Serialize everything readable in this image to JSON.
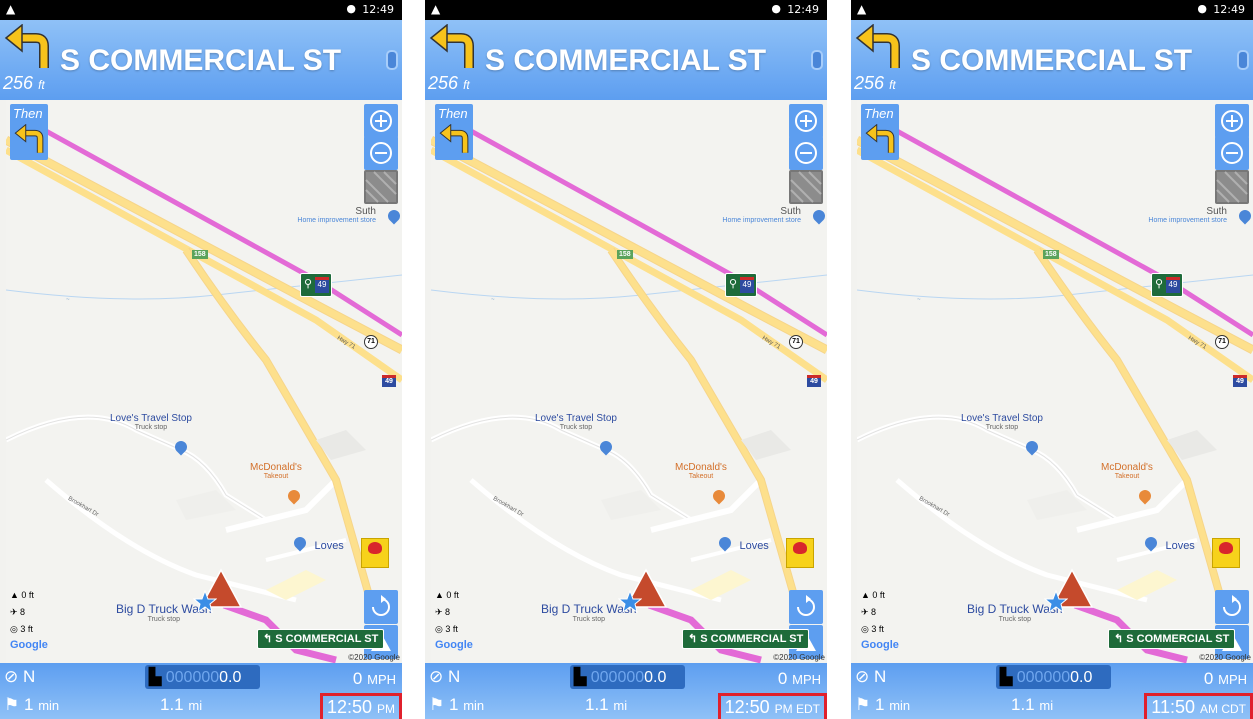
{
  "status_bar": {
    "time": "12:49"
  },
  "navigation": {
    "street": "S COMMERCIAL ST",
    "distance_value": "256",
    "distance_unit": "ft",
    "then_label": "Then"
  },
  "map": {
    "poi_loves_travel": {
      "name": "Love's Travel Stop",
      "sub": "Truck stop"
    },
    "poi_mcdonalds": {
      "name": "McDonald's",
      "sub": "Takeout"
    },
    "poi_loves": {
      "name": "Loves"
    },
    "poi_big_d": {
      "name": "Big D Truck Wash",
      "sub": "Truck stop"
    },
    "poi_sutherland": {
      "name": "Suth",
      "sub": "Home improvement store"
    },
    "road_label_1": "Brookhart Dr",
    "road_label_2": "Hwy 71",
    "shield_158": "158",
    "shield_71": "71",
    "shield_49": "49",
    "next_street_sign": "S COMMERCIAL ST",
    "copyright": "©2020 Google",
    "google_logo": "Google",
    "elevation": "0 ft",
    "satellites": "8",
    "accuracy": "3 ft"
  },
  "bottom": {
    "heading": "N",
    "odometer_dim": "000000",
    "odometer_lit": "0.0",
    "speed_value": "0",
    "speed_unit": "MPH",
    "eta_value": "1",
    "eta_unit": "min",
    "dist_value": "1.1",
    "dist_unit": "mi"
  },
  "panels": [
    {
      "clock_time": "12:50",
      "clock_suffix": "PM"
    },
    {
      "clock_time": "12:50",
      "clock_suffix": "PM EDT"
    },
    {
      "clock_time": "11:50",
      "clock_suffix": "AM CDT"
    }
  ],
  "colors": {
    "nav_blue": "#5d9ef0",
    "route_magenta": "#e36ad6",
    "highway_yellow": "#fde08c",
    "highlight_red": "#e0202c",
    "sign_green": "#1e6b3a"
  }
}
